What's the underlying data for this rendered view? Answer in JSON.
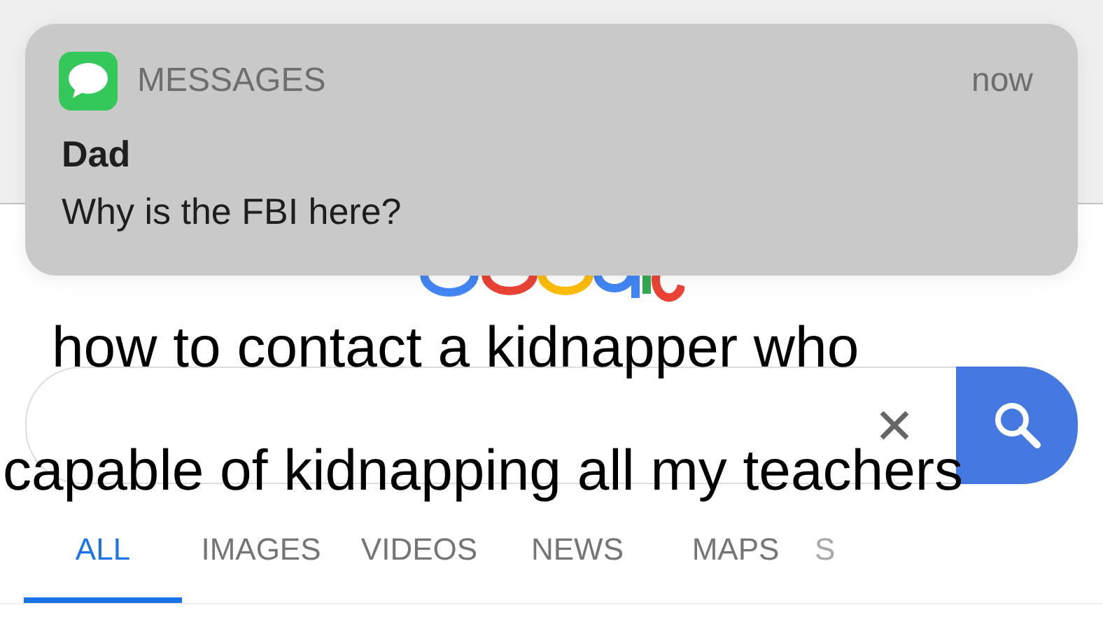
{
  "notification": {
    "app": "MESSAGES",
    "time": "now",
    "sender": "Dad",
    "message": "Why is the FBI here?"
  },
  "caption": [
    "how to contact a kidnapper who",
    "capable of kidnapping all my teachers"
  ],
  "tabs": [
    {
      "label": "ALL",
      "selected": true
    },
    {
      "label": "IMAGES",
      "selected": false
    },
    {
      "label": "VIDEOS",
      "selected": false
    },
    {
      "label": "NEWS",
      "selected": false
    },
    {
      "label": "MAPS",
      "selected": false
    },
    {
      "label": "S",
      "selected": false
    }
  ]
}
